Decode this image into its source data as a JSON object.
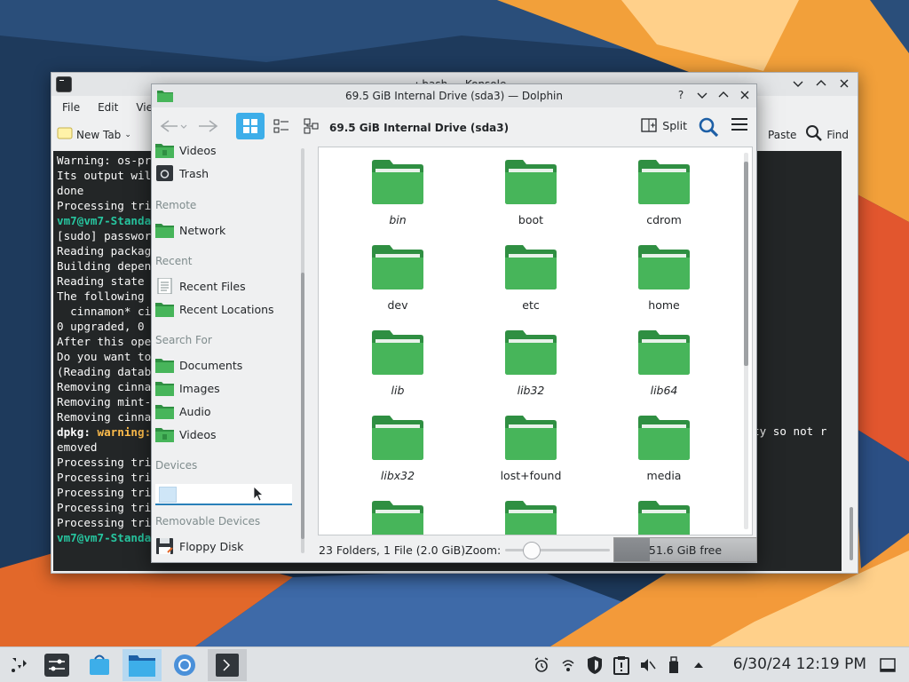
{
  "konsole": {
    "title": "~ : bash — Konsole",
    "menu": [
      "File",
      "Edit",
      "View"
    ],
    "toolbar": {
      "new_tab": "New Tab",
      "paste": "Paste",
      "find": "Find"
    },
    "terminal_lines": [
      {
        "text": "Warning: os-pr",
        "style": "normal"
      },
      {
        "text": "Its output wil",
        "style": "normal"
      },
      {
        "text": "done",
        "style": "normal"
      },
      {
        "text": "Processing tri",
        "style": "normal"
      },
      {
        "text": "vm7@vm7-Standa",
        "style": "green"
      },
      {
        "text": "[sudo] passwor",
        "style": "normal"
      },
      {
        "text": "Reading packag",
        "style": "normal"
      },
      {
        "text": "Building depen",
        "style": "normal"
      },
      {
        "text": "Reading state ",
        "style": "normal"
      },
      {
        "text": "The following ",
        "style": "normal"
      },
      {
        "text": "  cinnamon* ci",
        "style": "normal"
      },
      {
        "text": "0 upgraded, 0 ",
        "style": "normal"
      },
      {
        "text": "After this ope",
        "style": "normal"
      },
      {
        "text": "Do you want to",
        "style": "normal"
      },
      {
        "text": "(Reading datab",
        "style": "normal"
      },
      {
        "text": "Removing cinna",
        "style": "normal"
      },
      {
        "text": "Removing mint-",
        "style": "normal"
      },
      {
        "text": "Removing cinna",
        "style": "normal"
      },
      {
        "text": "dpkg: ",
        "style": "bold",
        "suffix": "warning:"
      },
      {
        "text": "emoved",
        "style": "normal"
      },
      {
        "text": "Processing tri",
        "style": "normal"
      },
      {
        "text": "Processing tri",
        "style": "normal"
      },
      {
        "text": "Processing tri",
        "style": "normal"
      },
      {
        "text": "Processing tri",
        "style": "normal"
      },
      {
        "text": "Processing tri",
        "style": "normal"
      },
      {
        "text": "vm7@vm7-Standa",
        "style": "green"
      }
    ],
    "side_text": "ty so not r"
  },
  "dolphin": {
    "title": "69.5 GiB Internal Drive (sda3) — Dolphin",
    "location": "69.5 GiB Internal Drive (sda3)",
    "split_label": "Split",
    "places": {
      "items_top": [
        {
          "label": "Videos",
          "icon": "videos-folder-icon"
        },
        {
          "label": "Trash",
          "icon": "trash-icon"
        }
      ],
      "remote_heading": "Remote",
      "remote_items": [
        {
          "label": "Network",
          "icon": "network-folder-icon"
        }
      ],
      "recent_heading": "Recent",
      "recent_items": [
        {
          "label": "Recent Files",
          "icon": "recent-files-icon"
        },
        {
          "label": "Recent Locations",
          "icon": "recent-locations-icon"
        }
      ],
      "search_heading": "Search For",
      "search_items": [
        {
          "label": "Documents",
          "icon": "documents-folder-icon"
        },
        {
          "label": "Images",
          "icon": "images-folder-icon"
        },
        {
          "label": "Audio",
          "icon": "audio-folder-icon"
        },
        {
          "label": "Videos",
          "icon": "videos-folder-icon"
        }
      ],
      "devices_heading": "Devices",
      "removable_heading": "Removable Devices",
      "removable_items": [
        {
          "label": "Floppy Disk",
          "icon": "floppy-disk-icon"
        }
      ]
    },
    "folders": [
      {
        "name": "bin",
        "italic": true
      },
      {
        "name": "boot",
        "italic": false
      },
      {
        "name": "cdrom",
        "italic": false
      },
      {
        "name": "dev",
        "italic": false
      },
      {
        "name": "etc",
        "italic": false
      },
      {
        "name": "home",
        "italic": false
      },
      {
        "name": "lib",
        "italic": true
      },
      {
        "name": "lib32",
        "italic": true
      },
      {
        "name": "lib64",
        "italic": true
      },
      {
        "name": "libx32",
        "italic": true
      },
      {
        "name": "lost+found",
        "italic": false
      },
      {
        "name": "media",
        "italic": false
      },
      {
        "name": "",
        "italic": false
      },
      {
        "name": "",
        "italic": false
      },
      {
        "name": "",
        "italic": false
      }
    ],
    "status": {
      "info": "23 Folders, 1 File (2.0 GiB)",
      "zoom_label": "Zoom:",
      "free_space": "51.6 GiB free"
    }
  },
  "taskbar": {
    "clock": "6/30/24 12:19 PM"
  },
  "colors": {
    "folder_green": "#47b55a",
    "folder_green_dark": "#2f8f42",
    "accent_blue": "#3daee9",
    "terminal_bg": "#232627"
  }
}
